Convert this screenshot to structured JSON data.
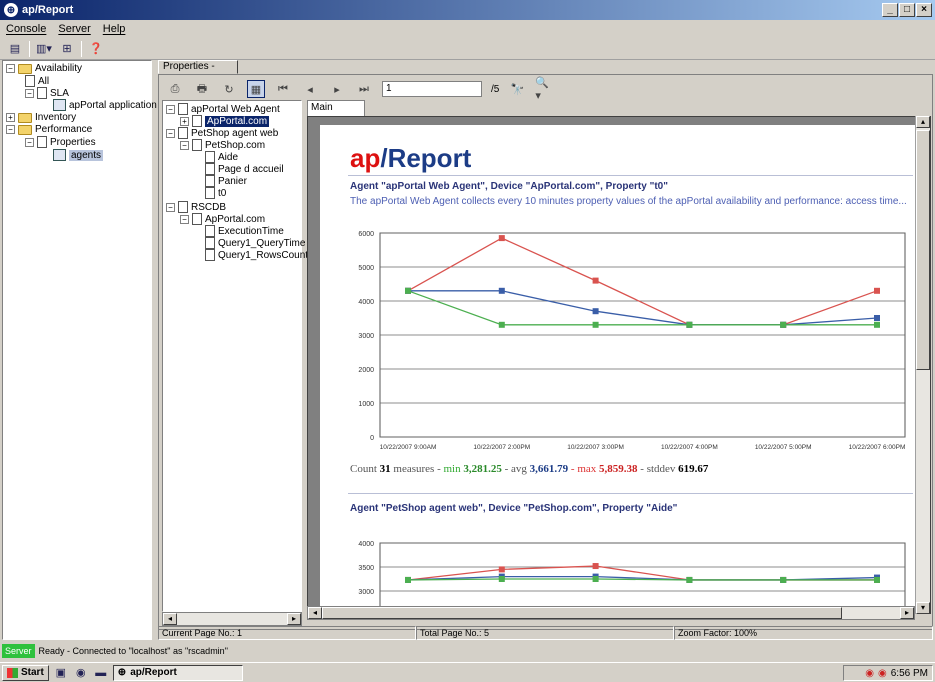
{
  "window": {
    "title": "ap/Report",
    "min": "_",
    "max": "□",
    "close": "×"
  },
  "menu": [
    "Console",
    "Server",
    "Help"
  ],
  "left_tree": {
    "items": [
      {
        "label": "Availability"
      },
      {
        "label": "All"
      },
      {
        "label": "SLA"
      },
      {
        "label": "apPortal application"
      },
      {
        "label": "Inventory"
      },
      {
        "label": "Performance"
      },
      {
        "label": "Properties"
      },
      {
        "label": "agents"
      }
    ]
  },
  "properties_tab": "Properties - agents",
  "viewer": {
    "page_value": "1",
    "page_total": "/5",
    "main_tab": "Main Report"
  },
  "doc_tree": [
    "apPortal Web Agent",
    "ApPortal.com",
    "PetShop agent web",
    "PetShop.com",
    "Aide",
    "Page d accueil",
    "Panier",
    "t0",
    "RSCDB",
    "ApPortal.com",
    "ExecutionTime",
    "Query1_QueryTime",
    "Query1_RowsCount"
  ],
  "report": {
    "logo_a": "ap",
    "logo_b": "/Report",
    "chart1_title": "Agent \"apPortal Web Agent\", Device \"ApPortal.com\", Property \"t0\"",
    "chart1_desc": "The apPortal Web Agent collects every 10 minutes property values of the apPortal availability and performance: access time...",
    "stats": {
      "count_label": "Count",
      "count": "31",
      "count_unit": "measures -",
      "min_label": "min",
      "min": "3,281.25",
      "avg_label": "- avg",
      "avg": "3,661.79",
      "max_label": "- max",
      "max": "5,859.38",
      "std_label": "- stddev",
      "std": "619.67"
    },
    "chart2_title": "Agent \"PetShop agent web\", Device \"PetShop.com\", Property \"Aide\""
  },
  "status": {
    "current_page": "Current Page No.: 1",
    "total_page": "Total Page No.: 5",
    "zoom": "Zoom Factor: 100%"
  },
  "app_status": {
    "badge": "Server",
    "text": "Ready - Connected to \"localhost\" as \"rscadmin\""
  },
  "taskbar": {
    "start": "Start",
    "task": "ap/Report",
    "clock": "6:56 PM"
  },
  "colors": {
    "red": "#d9534f",
    "blue": "#3a5ea8",
    "green": "#4caf50",
    "accent": "#0a246a"
  },
  "chart_data": [
    {
      "type": "line",
      "ylim": [
        0,
        6000
      ],
      "yticks": [
        "6000",
        "5000",
        "4000",
        "3000",
        "2000",
        "1000",
        "0"
      ],
      "categories": [
        "10/22/2007 9:00AM",
        "10/22/2007 2:00PM",
        "10/22/2007 3:00PM",
        "10/22/2007 4:00PM",
        "10/22/2007 5:00PM",
        "10/22/2007 6:00PM"
      ],
      "series": [
        {
          "color": "#d9534f",
          "values": [
            4300,
            5850,
            4600,
            3300,
            3300,
            4300
          ]
        },
        {
          "color": "#3a5ea8",
          "values": [
            4300,
            4300,
            3700,
            3300,
            3300,
            3500
          ]
        },
        {
          "color": "#4caf50",
          "values": [
            4300,
            3300,
            3300,
            3300,
            3300,
            3300
          ]
        }
      ]
    },
    {
      "type": "line",
      "ylim": [
        2500,
        4000
      ],
      "yticks": [
        "4000",
        "3500",
        "3000"
      ],
      "categories": [
        "",
        "",
        "",
        "",
        "",
        ""
      ],
      "series": [
        {
          "color": "#d9534f",
          "values": [
            3230,
            3450,
            3520,
            3230,
            3230,
            3230
          ]
        },
        {
          "color": "#3a5ea8",
          "values": [
            3230,
            3300,
            3300,
            3230,
            3230,
            3280
          ]
        },
        {
          "color": "#4caf50",
          "values": [
            3230,
            3250,
            3250,
            3230,
            3230,
            3230
          ]
        }
      ]
    }
  ]
}
